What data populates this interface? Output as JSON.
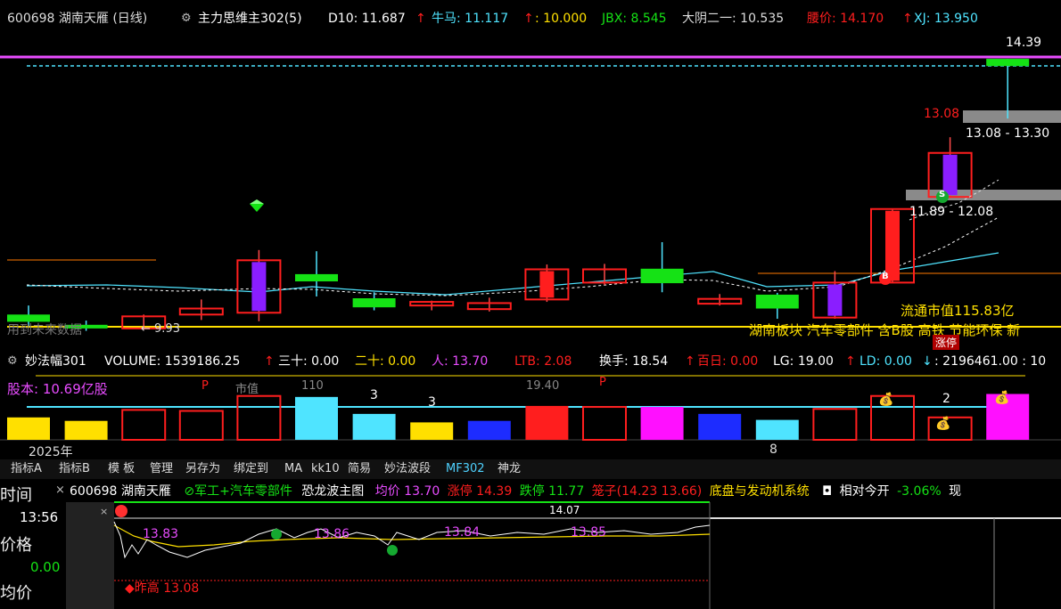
{
  "colors": {
    "up": "#ff1e1e",
    "down": "#15e215",
    "accent": "#e84cff",
    "cyan": "#4fe4ff",
    "yellow": "#ffe000",
    "orange": "#ff7a00"
  },
  "header": {
    "code_name": "600698 湖南天雁 (日线)",
    "indicator": "主力思维主302(5)",
    "d10_label": "D10: 11.687",
    "niuma_label": "牛马: 11.117",
    "ten_label": ": 10.000",
    "jbx_label": "JBX: 8.545",
    "dayin_label": "大阴二一: 10.535",
    "yaojia_label": "腰价: 14.170",
    "xj_label": "XJ: 13.950"
  },
  "main": {
    "price_top": "14.39",
    "box1": "13.08 - 13.30",
    "box2": "11.89 - 12.08",
    "label_1308": "13.08",
    "low_label": "← 9.93",
    "market_value": "流通市值115.83亿",
    "sector": "湖南板块 汽车零部件 含B股 高铁 节能环保 新",
    "zhangting": "涨停",
    "future_label": "用到未来数据",
    "s_badge": "S",
    "b_badge": "B",
    "candles": [
      {
        "o": 10.15,
        "c": 10.03,
        "h": 10.3,
        "l": 9.96,
        "up": false
      },
      {
        "o": 9.98,
        "c": 9.92,
        "h": 10.05,
        "l": 9.88,
        "up": false
      },
      {
        "o": 9.92,
        "c": 10.12,
        "h": 10.15,
        "l": 9.9,
        "up": true
      },
      {
        "o": 10.15,
        "c": 10.25,
        "h": 10.4,
        "l": 10.06,
        "up": true
      },
      {
        "o": 10.18,
        "c": 11.05,
        "h": 11.22,
        "l": 10.04,
        "up": true
      },
      {
        "o": 10.82,
        "c": 10.7,
        "h": 11.2,
        "l": 10.45,
        "up": false
      },
      {
        "o": 10.42,
        "c": 10.27,
        "h": 10.52,
        "l": 10.22,
        "up": false
      },
      {
        "o": 10.3,
        "c": 10.36,
        "h": 10.38,
        "l": 10.22,
        "up": true
      },
      {
        "o": 10.24,
        "c": 10.34,
        "h": 10.43,
        "l": 10.2,
        "up": true
      },
      {
        "o": 10.4,
        "c": 10.9,
        "h": 10.98,
        "l": 10.36,
        "up": true
      },
      {
        "o": 10.68,
        "c": 10.9,
        "h": 10.99,
        "l": 10.64,
        "up": true
      },
      {
        "o": 10.91,
        "c": 10.67,
        "h": 11.35,
        "l": 10.52,
        "up": false
      },
      {
        "o": 10.33,
        "c": 10.41,
        "h": 10.49,
        "l": 10.3,
        "up": true
      },
      {
        "o": 10.48,
        "c": 10.25,
        "h": 10.51,
        "l": 10.08,
        "up": false
      },
      {
        "o": 10.1,
        "c": 10.68,
        "h": 10.87,
        "l": 10.08,
        "up": true
      },
      {
        "o": 10.68,
        "c": 11.9,
        "h": 11.9,
        "l": 10.68,
        "up": true
      },
      {
        "o": 12.1,
        "c": 12.83,
        "h": 13.09,
        "l": 12.08,
        "up": true
      },
      {
        "o": 14.39,
        "c": 14.27,
        "h": 14.39,
        "l": 13.4,
        "up": false
      }
    ]
  },
  "volume": {
    "indicator": "妙法幅301",
    "volume_label": "VOLUME: 1539186.25",
    "thirty": "三十: 0.00",
    "twenty": "二十: 0.00",
    "ren": "人: 13.70",
    "ltb": "LTB: 2.08",
    "huanshou": "换手: 18.54",
    "bairi": "百日: 0.00",
    "lg": "LG: 19.00",
    "ld": "LD: 0.00",
    "tail": ": 2196461.00 : 10",
    "guben": "股本: 10.69亿股",
    "year": "2025年",
    "p": "P",
    "num3": "3",
    "num2": "2",
    "num8": "8",
    "num1940": "19.40",
    "shizhi": "市值",
    "val110": "110",
    "bars": [
      {
        "v": 0.45,
        "c": "#ffe000"
      },
      {
        "v": 0.38,
        "c": "#ffe000"
      },
      {
        "v": 0.6,
        "c": "hollow"
      },
      {
        "v": 0.58,
        "c": "hollow"
      },
      {
        "v": 0.88,
        "c": "hollow"
      },
      {
        "v": 0.86,
        "c": "#4fe4ff"
      },
      {
        "v": 0.52,
        "c": "#4fe4ff"
      },
      {
        "v": 0.35,
        "c": "#ffe000"
      },
      {
        "v": 0.38,
        "c": "#1d2cff"
      },
      {
        "v": 0.68,
        "c": "#ff1e1e"
      },
      {
        "v": 0.66,
        "c": "hollow"
      },
      {
        "v": 0.66,
        "c": "#ff10ff"
      },
      {
        "v": 0.52,
        "c": "#1d2cff"
      },
      {
        "v": 0.4,
        "c": "#4fe4ff"
      },
      {
        "v": 0.62,
        "c": "hollow"
      },
      {
        "v": 0.88,
        "c": "hollow"
      },
      {
        "v": 0.45,
        "c": "hollow"
      },
      {
        "v": 0.92,
        "c": "#ff10ff"
      }
    ]
  },
  "tabs": [
    "指标A",
    "指标B",
    "模 板",
    "管理",
    "另存为",
    "绑定到",
    "MA",
    "kk10",
    "简易",
    "妙法波段",
    "MF302",
    "神龙"
  ],
  "intraday": {
    "time_label": "时间",
    "time_value": "13:56",
    "price_label": "价格",
    "price_value": "0.00",
    "avg_label": "均价",
    "stock": "600698 湖南天雁",
    "concept": "⊘军工+汽车零部件",
    "wave": "恐龙波主图",
    "avg": "均价 13.70",
    "limit_up": "涨停 14.39",
    "limit_down": "跌停 11.77",
    "cage": "笼子(14.23 13.66)",
    "sector": "底盘与发动机系统",
    "rel_open": "相对今开",
    "rel_value": "-3.06%",
    "tail": "现",
    "high_mark": "14.07",
    "p1": "13.83",
    "p2": "13.86",
    "p3": "13.84",
    "p4": "13.85",
    "yest_high": "◆昨高  13.08"
  }
}
